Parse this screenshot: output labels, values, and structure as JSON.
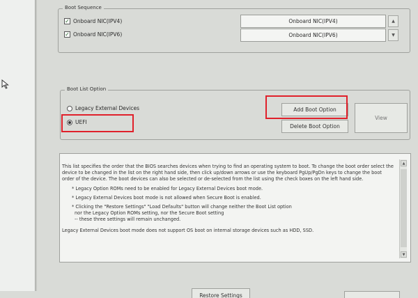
{
  "boot_sequence": {
    "legend": "Boot Sequence",
    "items": [
      {
        "label": "Onboard NIC(IPV4)",
        "checked": true,
        "order_value": "Onboard NIC(IPV4)"
      },
      {
        "label": "Onboard NIC(IPV6)",
        "checked": true,
        "order_value": "Onboard NIC(IPV6)"
      }
    ]
  },
  "boot_list_option": {
    "legend": "Boot List Option",
    "options": [
      {
        "label": "Legacy External Devices",
        "selected": false
      },
      {
        "label": "UEFI",
        "selected": true
      }
    ],
    "add_label": "Add Boot Option",
    "delete_label": "Delete Boot Option",
    "view_label": "View"
  },
  "help": {
    "para1": "This list specifies the order that the BIOS searches devices when trying to find an operating system to boot. To change the boot order select the device to be changed in the list on the right hand side, then click up/down arrows or use the keyboard PgUp/PgDn keys to change the boot order of the device. The boot devices can also be selected or de-selected from the list using the check boxes on the left hand side.",
    "bullet1": "* Legacy Option ROMs need to be enabled for Legacy External Devices boot mode.",
    "bullet2": "* Legacy External Devices boot mode is not allowed when Secure Boot is enabled.",
    "bullet3a": "* Clicking the \"Restore Settings\" \"Load Defaults\" button will change neither the Boot List option",
    "bullet3b": "nor the Legacy Option ROMs setting, nor the Secure Boot setting",
    "bullet3c": "-- these three settings will remain unchanged.",
    "para_end": "Legacy External Devices boot mode does not support OS boot on internal storage devices such as HDD, SSD."
  },
  "footer": {
    "restore_label": "Restore Settings"
  },
  "colors": {
    "highlight": "#e0202a",
    "background": "#d9dbd7"
  }
}
